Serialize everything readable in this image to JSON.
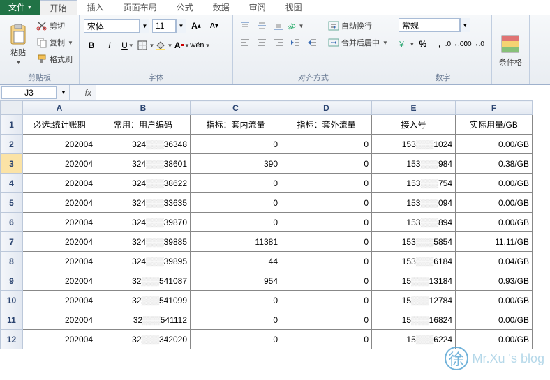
{
  "tabs": {
    "file": "文件",
    "items": [
      "开始",
      "插入",
      "页面布局",
      "公式",
      "数据",
      "审阅",
      "视图"
    ],
    "active": 0
  },
  "ribbon": {
    "clipboard": {
      "paste": "粘贴",
      "cut": "剪切",
      "copy": "复制",
      "format_painter": "格式刷",
      "label": "剪贴板"
    },
    "font": {
      "name": "宋体",
      "size": "11",
      "bold": "B",
      "italic": "I",
      "underline": "U",
      "label": "字体"
    },
    "align": {
      "wrap": "自动换行",
      "merge": "合并后居中",
      "label": "对齐方式"
    },
    "number": {
      "format": "常规",
      "label": "数字"
    },
    "styles": {
      "conditional": "条件格"
    }
  },
  "formula_bar": {
    "name_box": "J3",
    "fx": "fx",
    "value": ""
  },
  "grid": {
    "columns": [
      "A",
      "B",
      "C",
      "D",
      "E",
      "F"
    ],
    "headers": [
      "必选:统计账期",
      "常用：用户编码",
      "指标：套内流量",
      "指标：套外流量",
      "接入号",
      "实际用量/GB"
    ],
    "rows": [
      {
        "n": 1
      },
      {
        "n": 2,
        "a": "202004",
        "b_pre": "324",
        "b_suf": "36348",
        "c": "0",
        "d": "0",
        "e_pre": "153",
        "e_suf": "1024",
        "f": "0.00/GB"
      },
      {
        "n": 3,
        "a": "202004",
        "b_pre": "324",
        "b_suf": "38601",
        "c": "390",
        "d": "0",
        "e_pre": "153",
        "e_suf": "984",
        "f": "0.38/GB",
        "sel": true
      },
      {
        "n": 4,
        "a": "202004",
        "b_pre": "324",
        "b_suf": "38622",
        "c": "0",
        "d": "0",
        "e_pre": "153",
        "e_suf": "754",
        "f": "0.00/GB"
      },
      {
        "n": 5,
        "a": "202004",
        "b_pre": "324",
        "b_suf": "33635",
        "c": "0",
        "d": "0",
        "e_pre": "153",
        "e_suf": "094",
        "f": "0.00/GB"
      },
      {
        "n": 6,
        "a": "202004",
        "b_pre": "324",
        "b_suf": "39870",
        "c": "0",
        "d": "0",
        "e_pre": "153",
        "e_suf": "894",
        "f": "0.00/GB"
      },
      {
        "n": 7,
        "a": "202004",
        "b_pre": "324",
        "b_suf": "39885",
        "c": "11381",
        "d": "0",
        "e_pre": "153",
        "e_suf": "5854",
        "f": "11.11/GB"
      },
      {
        "n": 8,
        "a": "202004",
        "b_pre": "324",
        "b_suf": "39895",
        "c": "44",
        "d": "0",
        "e_pre": "153",
        "e_suf": "6184",
        "f": "0.04/GB"
      },
      {
        "n": 9,
        "a": "202004",
        "b_pre": "32",
        "b_suf": "541087",
        "c": "954",
        "d": "0",
        "e_pre": "15",
        "e_suf": "13184",
        "f": "0.93/GB"
      },
      {
        "n": 10,
        "a": "202004",
        "b_pre": "32",
        "b_suf": "541099",
        "c": "0",
        "d": "0",
        "e_pre": "15",
        "e_suf": "12784",
        "f": "0.00/GB"
      },
      {
        "n": 11,
        "a": "202004",
        "b_pre": "32",
        "b_suf": "541112",
        "c": "0",
        "d": "0",
        "e_pre": "15",
        "e_suf": "16824",
        "f": "0.00/GB"
      },
      {
        "n": 12,
        "a": "202004",
        "b_pre": "32",
        "b_suf": "342020",
        "c": "0",
        "d": "0",
        "e_pre": "15",
        "e_suf": "6224",
        "f": "0.00/GB"
      }
    ]
  },
  "watermark": {
    "char": "徐",
    "text": "Mr.Xu 's blog"
  }
}
